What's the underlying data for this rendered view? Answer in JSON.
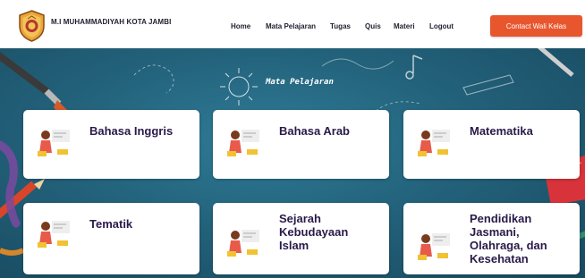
{
  "header": {
    "brand": "M.I MUHAMMADIYAH KOTA JAMBI",
    "nav": [
      "Home",
      "Mata Pelajaran",
      "Tugas",
      "Quis",
      "Materi",
      "Logout"
    ],
    "cta": "Contact Wali Kelas"
  },
  "hero": {
    "title": "Mata Pelajaran"
  },
  "subjects": [
    "Bahasa Inggris",
    "Bahasa Arab",
    "Matematika",
    "Tematik",
    "Sejarah Kebudayaan Islam",
    "Pendidikan Jasmani, Olahraga, dan Kesehatan"
  ],
  "colors": {
    "accent": "#e8562e",
    "hero": "#23627b",
    "label": "#2a1a4a"
  }
}
